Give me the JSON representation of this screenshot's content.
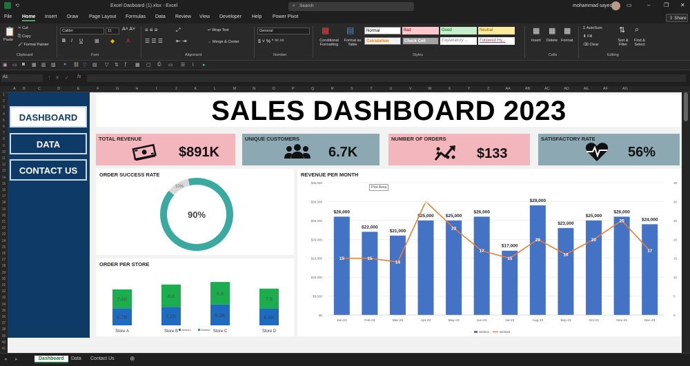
{
  "window": {
    "title": "Excel Dasboard (1).xlsx - Excel",
    "search_placeholder": "Search",
    "user": "mohammad sayed"
  },
  "menu": [
    "File",
    "Home",
    "Insert",
    "Draw",
    "Page Layout",
    "Formulas",
    "Data",
    "Review",
    "View",
    "Developer",
    "Help",
    "Power Pivot"
  ],
  "share_label": "Share",
  "ribbon": {
    "clipboard": {
      "paste": "Paste",
      "cut": "Cut",
      "copy": "Copy",
      "format_painter": "Format Painter",
      "group": "Clipboard"
    },
    "font": {
      "name": "Calibri",
      "size": "11",
      "group": "Font"
    },
    "alignment": {
      "wrap": "Wrap Text",
      "merge": "Merge & Center",
      "group": "Alignment"
    },
    "number": {
      "format": "General",
      "group": "Number"
    },
    "styles": {
      "conditional": "Conditional Formatting",
      "format_table": "Format as Table",
      "cells": [
        "Normal",
        "Bad",
        "Good",
        "Neutral",
        "Calculation",
        "Check Cell",
        "Explanatory ...",
        "Followed Hy..."
      ],
      "group": "Styles"
    },
    "cells": {
      "insert": "Insert",
      "delete": "Delete",
      "format": "Format",
      "group": "Cells"
    },
    "editing": {
      "autosum": "AutoSum",
      "fill": "Fill",
      "clear": "Clear",
      "sort": "Sort & Filter",
      "find": "Find & Select",
      "group": "Editing"
    }
  },
  "namebox": "A1",
  "fx": "fx",
  "columns": [
    "A",
    "B",
    "C",
    "D",
    "E",
    "F",
    "G",
    "H",
    "I",
    "J",
    "K",
    "L",
    "M",
    "N",
    "O",
    "P",
    "Q",
    "R",
    "S",
    "T",
    "U",
    "V",
    "W",
    "X",
    "Y",
    "Z",
    "AA",
    "AB",
    "AC",
    "AD",
    "AE",
    "AF",
    "AG"
  ],
  "rows": [
    "1",
    "2",
    "3",
    "4",
    "5",
    "6",
    "7",
    "8",
    "9",
    "10",
    "11",
    "12",
    "13",
    "14",
    "15",
    "16",
    "17",
    "18",
    "19",
    "20",
    "21",
    "22",
    "23",
    "24",
    "25",
    "26",
    "27",
    "28",
    "29",
    "30",
    "31",
    "32",
    "33",
    "34",
    "35",
    "36",
    "37",
    "38",
    "39",
    "40",
    "41"
  ],
  "nav": {
    "dashboard": "DASHBOARD",
    "data": "DATA",
    "contact": "CONTACT US"
  },
  "dashboard_title": "SALES DASHBOARD 2023",
  "kpis": [
    {
      "label": "TOTAL REVENUE",
      "value": "$891K",
      "color": "#f4b6bd",
      "icon": "cash-icon"
    },
    {
      "label": "UNIQUE CUSTOMERS",
      "value": "6.7K",
      "color": "#8ca8b3",
      "icon": "users-icon"
    },
    {
      "label": "NUMBER OF ORDERS",
      "value": "$133",
      "color": "#f4b6bd",
      "icon": "growth-icon"
    },
    {
      "label": "SATISFACTORY RATE",
      "value": "56%",
      "color": "#8ca8b3",
      "icon": "heartbeat-icon"
    }
  ],
  "order_success": {
    "title": "ORDER SUCCESS RATE",
    "center_label": "90%",
    "slice_label": "10%",
    "success": 0.9
  },
  "order_store": {
    "title": "ORDER PER STORE",
    "legend": [
      "Series1",
      "Series2"
    ]
  },
  "revenue_title": "REVENUE PER MONTH",
  "plot_area_tip": "Plot Area",
  "chart_data": [
    {
      "type": "pie",
      "title": "ORDER SUCCESS RATE",
      "categories": [
        "Success",
        "Failed"
      ],
      "values": [
        90,
        10
      ],
      "labels": [
        "90%",
        "10%"
      ],
      "colors": [
        "#3aa9a0",
        "#d9d9d9"
      ]
    },
    {
      "type": "bar",
      "title": "ORDER PER STORE",
      "stacked": true,
      "categories": [
        "Store A",
        "Store B",
        "Store C",
        "Store D"
      ],
      "series": [
        {
          "name": "Series1",
          "values": [
            6.7,
            7.2,
            8.2,
            6.6
          ],
          "labels": [
            "6.7K",
            "7.2K",
            "8.2K",
            "6.6K"
          ],
          "color": "#1f6bc0"
        },
        {
          "name": "Series2",
          "values": [
            7.4,
            8.8,
            8.8,
            7.8
          ],
          "labels": [
            "7.4K",
            "8.8",
            "8.8",
            "7.8"
          ],
          "color": "#1cae4e"
        }
      ],
      "legend": "bottom"
    },
    {
      "type": "bar",
      "title": "REVENUE PER MONTH",
      "categories": [
        "Jan-23",
        "Feb-23",
        "Mar-23",
        "Apr-23",
        "May-23",
        "Jun-23",
        "Jul-23",
        "Aug-23",
        "Sep-23",
        "Oct-23",
        "Nov-23",
        "Dec-23"
      ],
      "series": [
        {
          "name": "Series1",
          "type": "bar",
          "axis": "left",
          "values": [
            26000,
            22000,
            21000,
            25000,
            25000,
            26000,
            17000,
            29000,
            23000,
            25000,
            26000,
            24000
          ],
          "labels": [
            "$26,000",
            "$22,000",
            "$21,000",
            "$25,000",
            "$25,000",
            "$26,000",
            "$17,000",
            "$29,000",
            "$23,000",
            "$25,000",
            "$26,000",
            "$24,000"
          ],
          "color": "#4472c4"
        },
        {
          "name": "Series2",
          "type": "line",
          "axis": "right",
          "values": [
            15,
            15,
            14,
            30,
            23,
            17,
            15,
            20,
            16,
            20,
            25,
            17
          ],
          "color": "#ed7d31"
        }
      ],
      "ylim": [
        0,
        35000
      ],
      "yticks": [
        "$0",
        "$5,000",
        "$10,000",
        "$15,000",
        "$20,000",
        "$25,000",
        "$30,000",
        "$35,000"
      ],
      "y2lim": [
        0,
        35
      ],
      "y2ticks": [
        "0",
        "5",
        "10",
        "15",
        "20",
        "25",
        "30",
        "35"
      ],
      "legend": "bottom"
    }
  ],
  "sheet_tabs": [
    "Dashboard",
    "Data",
    "Contact Us"
  ]
}
